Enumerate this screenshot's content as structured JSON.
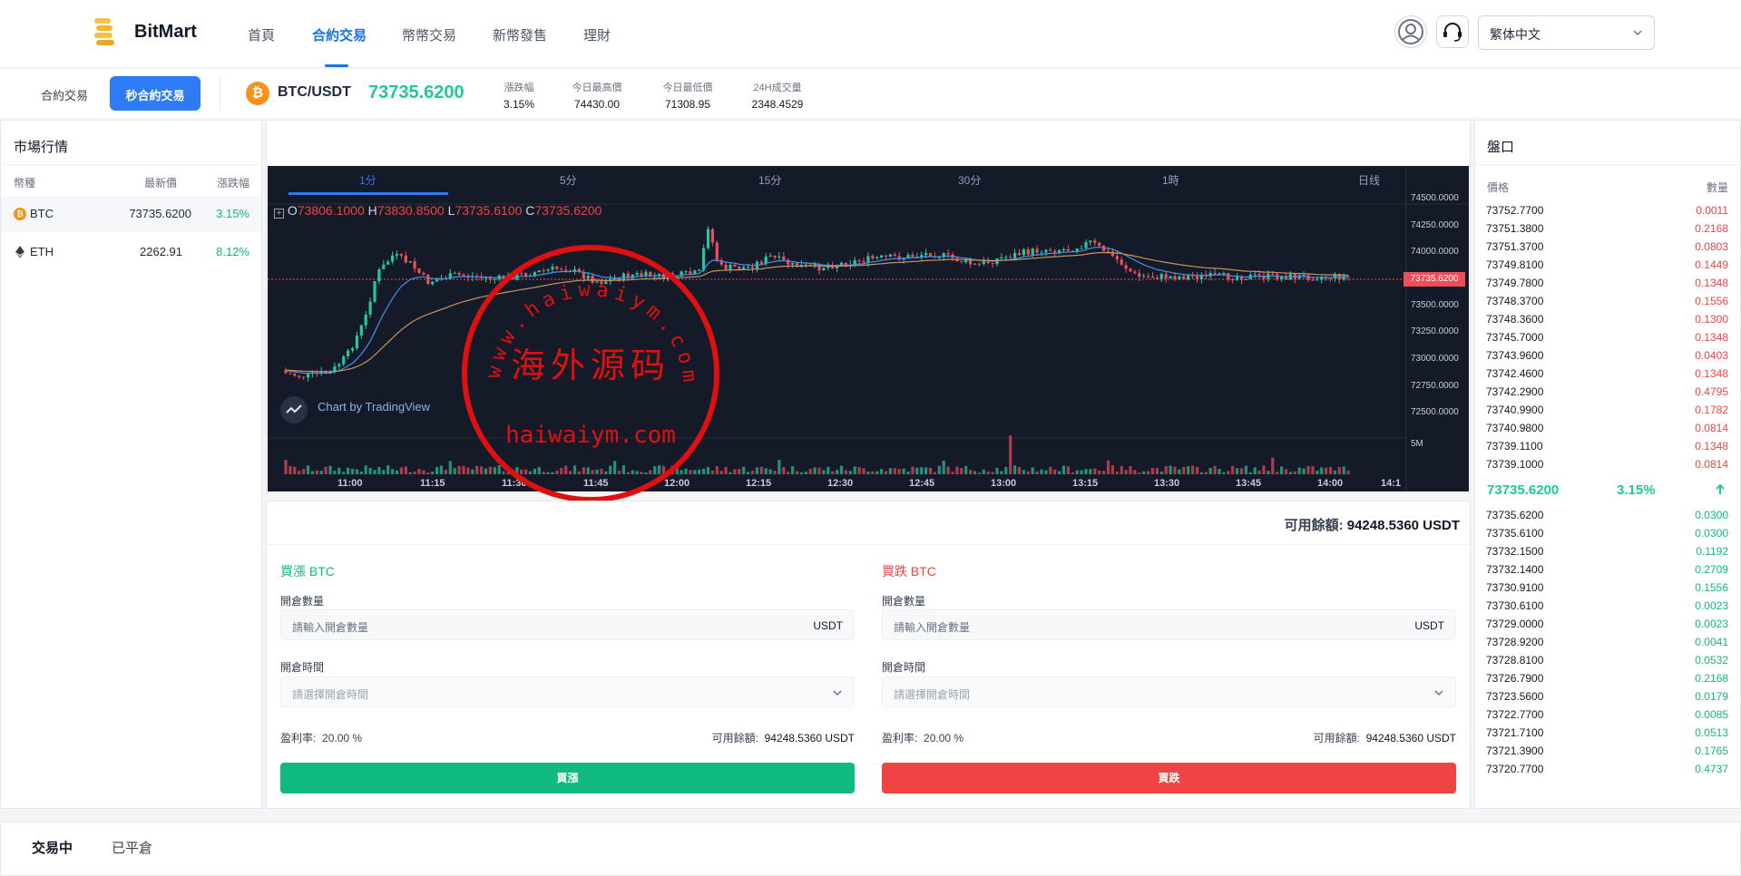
{
  "app": {
    "brand": "BitMart"
  },
  "nav": {
    "items": [
      "首頁",
      "合約交易",
      "幣幣交易",
      "新幣發售",
      "理財"
    ],
    "active_index": 1
  },
  "header": {
    "language": "繁体中文"
  },
  "ticker": {
    "mode_tabs": [
      "合約交易",
      "秒合約交易"
    ],
    "active_mode": 1,
    "pair": "BTC/USDT",
    "coin_symbol": "₿",
    "last_price": "73735.6200",
    "stats": [
      {
        "label": "漲跌幅",
        "value": "3.15%"
      },
      {
        "label": "今日最高價",
        "value": "74430.00"
      },
      {
        "label": "今日最低價",
        "value": "71308.95"
      },
      {
        "label": "24H成交量",
        "value": "2348.4529"
      }
    ]
  },
  "market": {
    "title": "市場行情",
    "headers": [
      "幣種",
      "最新價",
      "漲跌幅"
    ],
    "rows": [
      {
        "coin": "BTC",
        "price": "73735.6200",
        "change": "3.15%",
        "icon": "bitcoin-icon"
      },
      {
        "coin": "ETH",
        "price": "2262.91",
        "change": "8.12%",
        "icon": "ethereum-icon"
      }
    ]
  },
  "chart": {
    "timeframes": [
      "1分",
      "5分",
      "15分",
      "30分",
      "1時",
      "日线"
    ],
    "active_tf": 0,
    "ohlc": {
      "o": "73806.1000",
      "h": "73830.8500",
      "l": "73735.6100",
      "c": "73735.6200"
    },
    "watermark": "Chart by TradingView",
    "price_label": "73735.6200",
    "volume_label": "5M",
    "y_ticks": [
      "74500.0000",
      "74250.0000",
      "74000.0000",
      "73750.0000",
      "73500.0000",
      "73250.0000",
      "73000.0000",
      "72750.0000",
      "72500.0000"
    ],
    "x_ticks": [
      "11:00",
      "11:15",
      "11:30",
      "11:45",
      "12:00",
      "12:15",
      "12:30",
      "12:45",
      "13:00",
      "13:15",
      "13:30",
      "13:45",
      "14:00",
      "14:1"
    ],
    "colors": {
      "up": "#26c6a0",
      "down": "#ef4d5a",
      "bg": "#151a28"
    }
  },
  "stamp": {
    "top_text": "www.haiwaiym.com",
    "center_text": "海外源码",
    "bottom_text": "haiwaiym.com",
    "color": "#e01010"
  },
  "trade": {
    "available_label": "可用餘額:",
    "available_value": "94248.5360 USDT",
    "buy": {
      "title": "買漲 BTC",
      "qty_label": "開倉數量",
      "qty_placeholder": "請輸入開倉數量",
      "qty_unit": "USDT",
      "time_label": "開倉時間",
      "time_placeholder": "請選擇開倉時間",
      "rate_label": "盈利率:",
      "rate_value": "20.00 %",
      "avail_label": "可用餘額:",
      "avail_value": "94248.5360 USDT",
      "button": "買漲"
    },
    "sell": {
      "title": "買跌 BTC",
      "qty_label": "開倉數量",
      "qty_placeholder": "請輸入開倉數量",
      "qty_unit": "USDT",
      "time_label": "開倉時間",
      "time_placeholder": "請選擇開倉時間",
      "rate_label": "盈利率:",
      "rate_value": "20.00 %",
      "avail_label": "可用餘額:",
      "avail_value": "94248.5360 USDT",
      "button": "買跌"
    }
  },
  "orderbook": {
    "title": "盤口",
    "headers": [
      "價格",
      "數量"
    ],
    "asks": [
      [
        "73752.7700",
        "0.0011"
      ],
      [
        "73751.3800",
        "0.2168"
      ],
      [
        "73751.3700",
        "0.0803"
      ],
      [
        "73749.8100",
        "0.1449"
      ],
      [
        "73749.7800",
        "0.1348"
      ],
      [
        "73748.3700",
        "0.1556"
      ],
      [
        "73748.3600",
        "0.1300"
      ],
      [
        "73745.7000",
        "0.1348"
      ],
      [
        "73743.9600",
        "0.0403"
      ],
      [
        "73742.4600",
        "0.1348"
      ],
      [
        "73742.2900",
        "0.4795"
      ],
      [
        "73740.9900",
        "0.1782"
      ],
      [
        "73740.9800",
        "0.0814"
      ],
      [
        "73739.1100",
        "0.1348"
      ],
      [
        "73739.1000",
        "0.0814"
      ]
    ],
    "mid_price": "73735.6200",
    "mid_change": "3.15%",
    "bids": [
      [
        "73735.6200",
        "0.0300"
      ],
      [
        "73735.6100",
        "0.0300"
      ],
      [
        "73732.1500",
        "0.1192"
      ],
      [
        "73732.1400",
        "0.2709"
      ],
      [
        "73730.9100",
        "0.1556"
      ],
      [
        "73730.6100",
        "0.0023"
      ],
      [
        "73729.0000",
        "0.0023"
      ],
      [
        "73728.9200",
        "0.0041"
      ],
      [
        "73728.8100",
        "0.0532"
      ],
      [
        "73726.7900",
        "0.2168"
      ],
      [
        "73723.5600",
        "0.0179"
      ],
      [
        "73722.7700",
        "0.0085"
      ],
      [
        "73721.7100",
        "0.0513"
      ],
      [
        "73721.3900",
        "0.1765"
      ],
      [
        "73720.7700",
        "0.4737"
      ]
    ]
  },
  "bottom_tabs": [
    "交易中",
    "已平倉"
  ]
}
